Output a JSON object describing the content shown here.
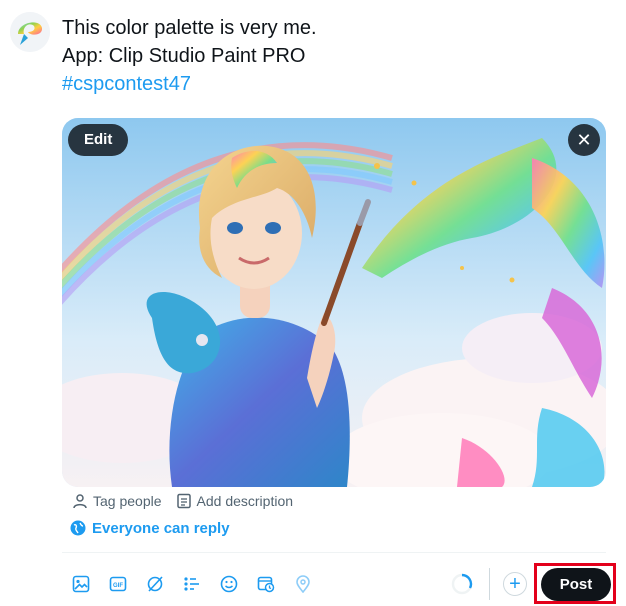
{
  "composer": {
    "lines": [
      "This color palette is very me.",
      "App: Clip Studio Paint PRO"
    ],
    "hashtag": "#cspcontest47"
  },
  "media": {
    "edit_label": "Edit",
    "close_symbol": "✕"
  },
  "media_actions": {
    "tag_people": "Tag people",
    "add_description": "Add description"
  },
  "reply_setting": {
    "label": "Everyone can reply",
    "icon": "globe-icon"
  },
  "toolbar": {
    "icons": [
      "image-icon",
      "gif-icon",
      "grok-icon",
      "poll-icon",
      "emoji-icon",
      "schedule-icon",
      "location-icon"
    ]
  },
  "thread": {
    "add_symbol": "+"
  },
  "post": {
    "label": "Post"
  },
  "colors": {
    "accent": "#1d9bf0",
    "post_button": "#0f1419",
    "highlight_border": "#e3001b"
  }
}
